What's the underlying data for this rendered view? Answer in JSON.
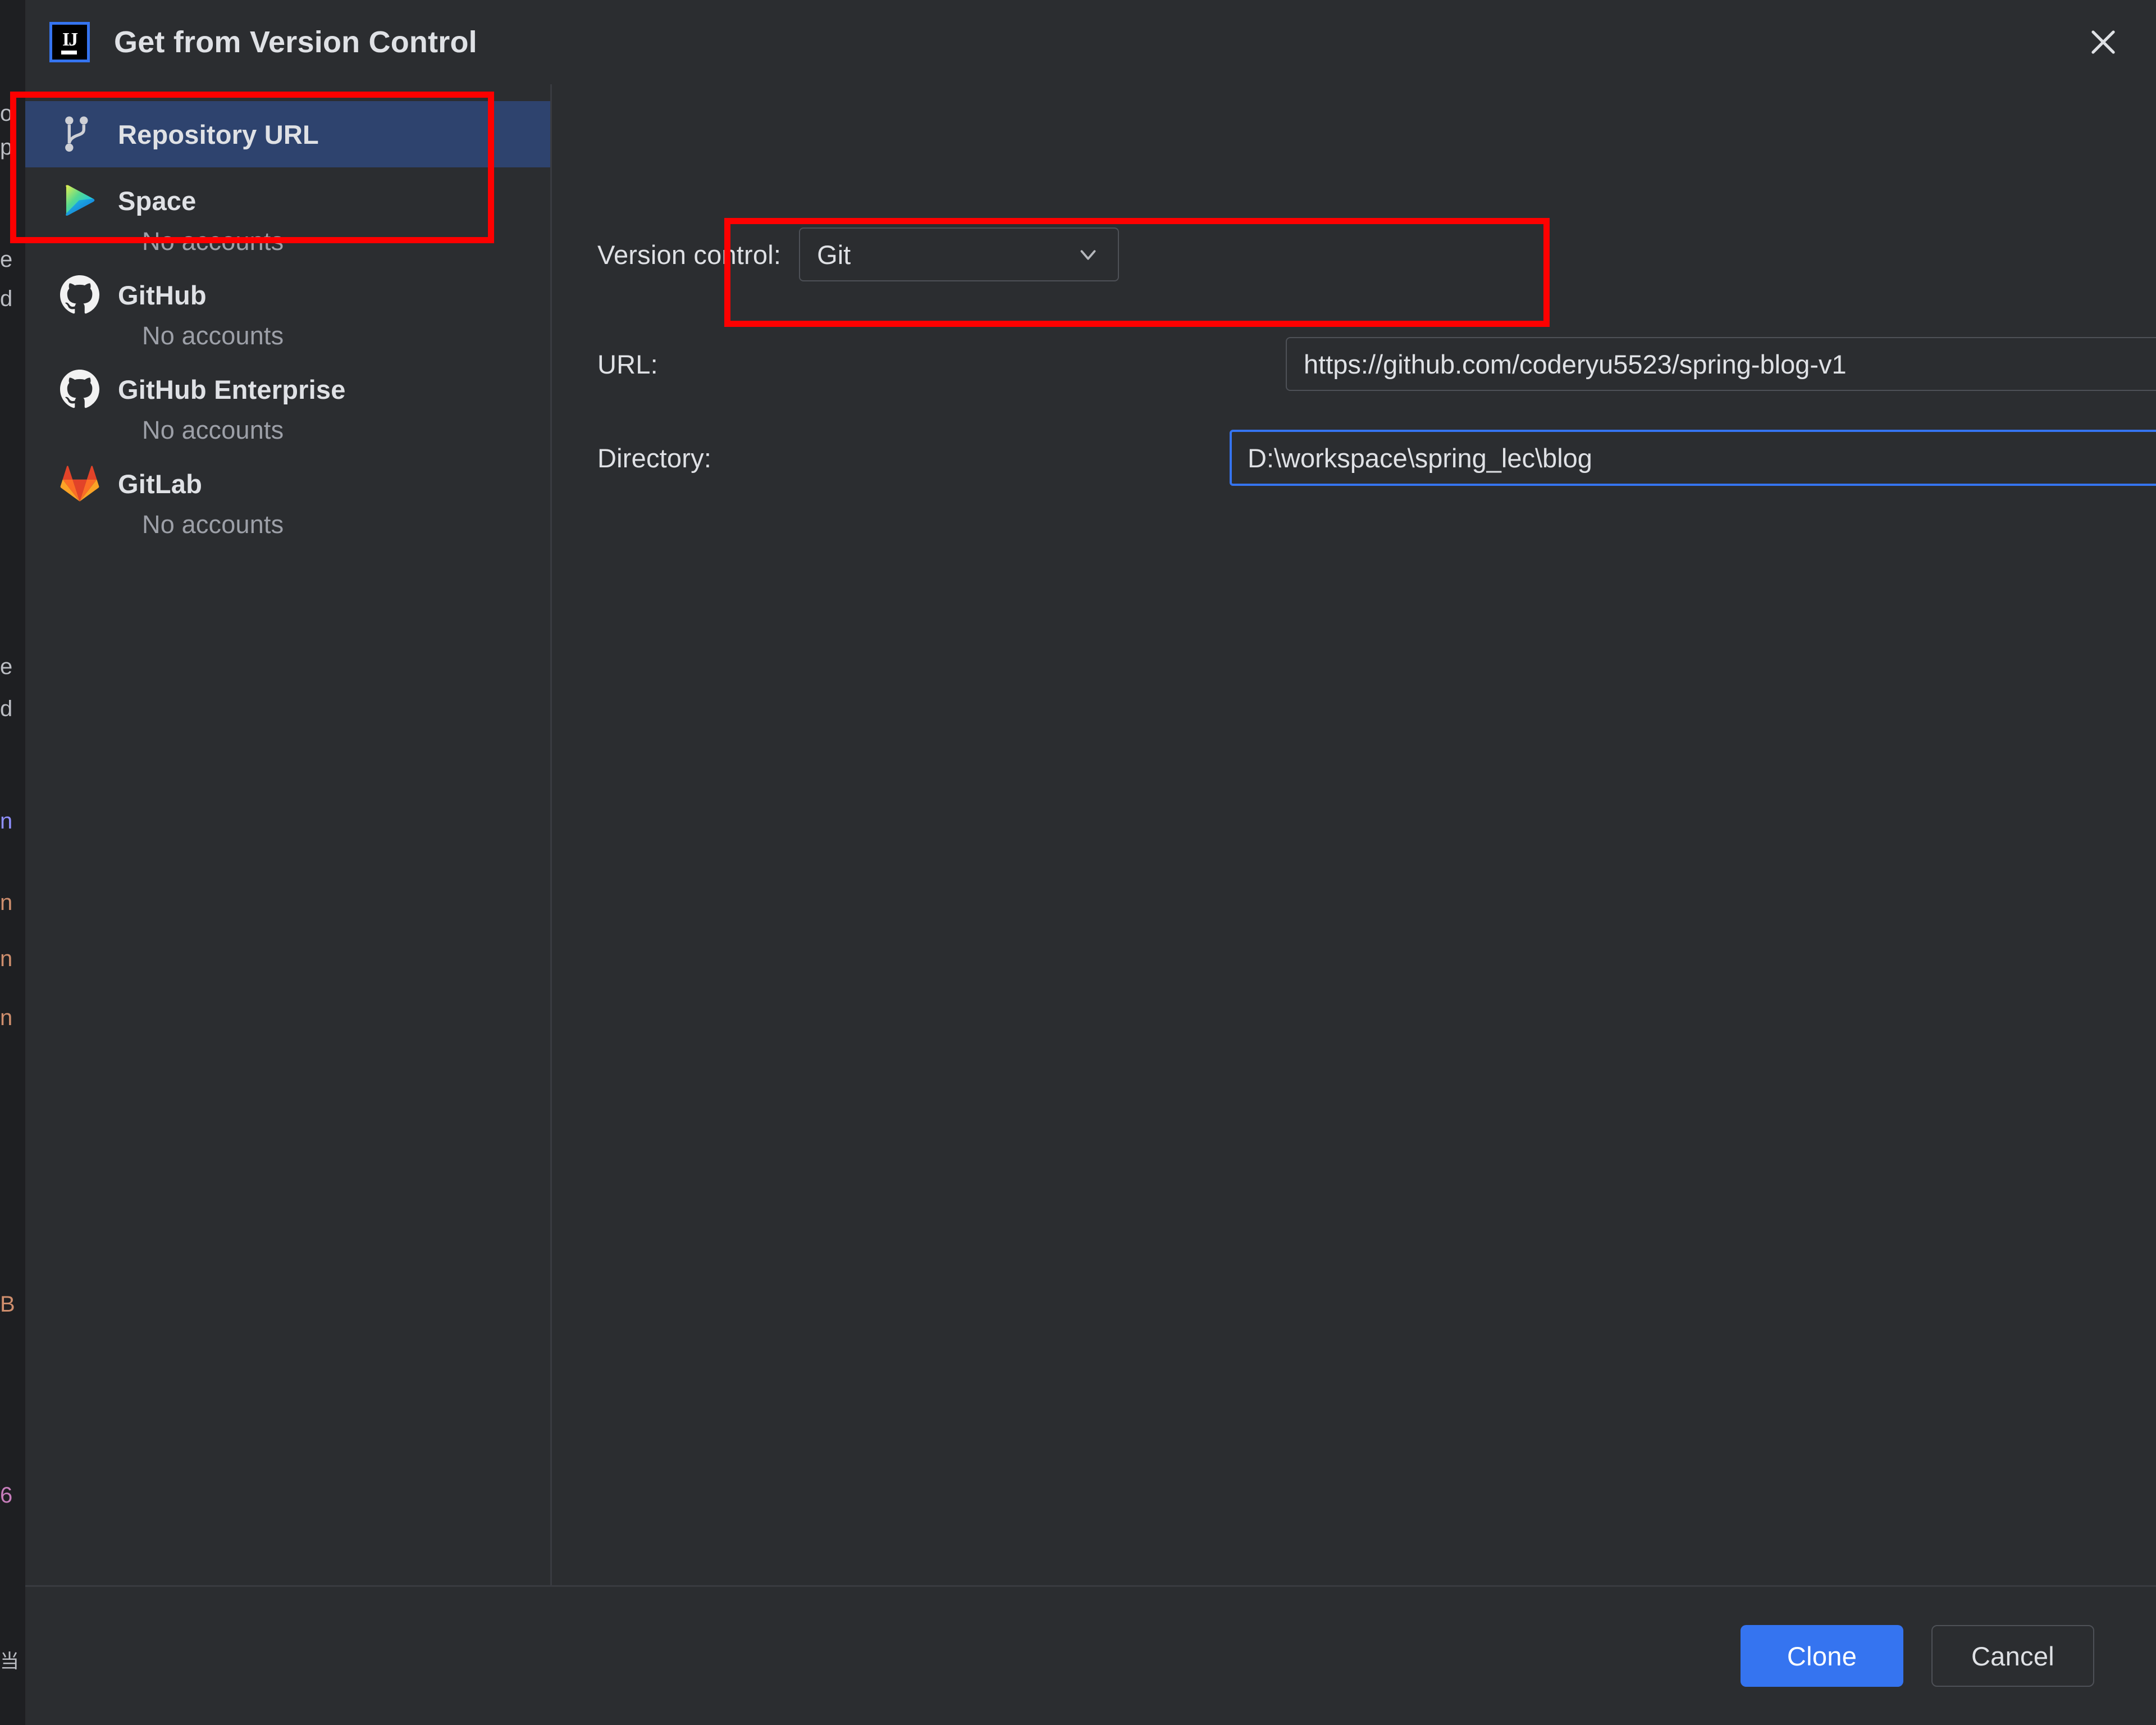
{
  "window": {
    "title": "Get from Version Control",
    "logo_text": "IJ",
    "close_icon": "close-icon"
  },
  "sidebar": {
    "items": [
      {
        "label": "Repository URL",
        "icon": "git-branch-icon",
        "sub": "",
        "selected": true
      },
      {
        "label": "Space",
        "icon": "jetbrains-space-icon",
        "sub": "No accounts",
        "selected": false
      },
      {
        "label": "GitHub",
        "icon": "github-icon",
        "sub": "No accounts",
        "selected": false
      },
      {
        "label": "GitHub Enterprise",
        "icon": "github-icon",
        "sub": "No accounts",
        "selected": false
      },
      {
        "label": "GitLab",
        "icon": "gitlab-icon",
        "sub": "No accounts",
        "selected": false
      }
    ]
  },
  "form": {
    "version_control": {
      "label": "Version control:",
      "value": "Git",
      "dropdown_icon": "chevron-down-icon"
    },
    "url": {
      "label": "URL:",
      "value": "https://github.com/coderyu5523/spring-blog-v1",
      "dropdown_icon": "chevron-down-icon"
    },
    "directory": {
      "label": "Directory:",
      "value": "D:\\workspace\\spring_lec\\blog",
      "browse_icon": "folder-icon"
    }
  },
  "footer": {
    "primary_button": "Clone",
    "secondary_button": "Cancel"
  },
  "annotations": {
    "highlight_color": "#fe0000",
    "boxes": [
      "repository-url-sidebar-item",
      "url-input-field"
    ]
  },
  "colors": {
    "dialog_background": "#2b2d30",
    "selection_blue": "#2e436e",
    "accent_blue": "#3574f0",
    "text_primary": "#dfe1e5",
    "text_secondary": "#9da0a8",
    "border": "#4e5157"
  },
  "background_fragments": {
    "rows": [
      "o",
      "p",
      "e",
      "d",
      "m",
      "n",
      "n",
      "n",
      "B",
      "6"
    ]
  }
}
